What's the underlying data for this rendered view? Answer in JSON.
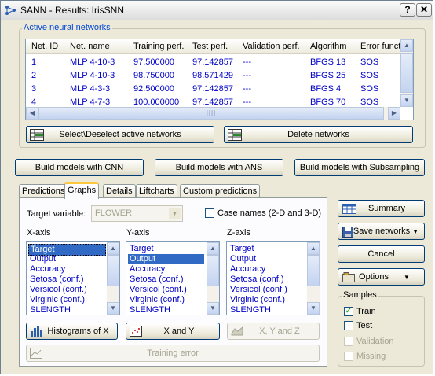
{
  "window": {
    "title": "SANN - Results: IrisSNN",
    "help_label": "?",
    "close_label": "✕"
  },
  "networks": {
    "group_label": "Active neural networks",
    "columns": [
      "Net. ID",
      "Net. name",
      "Training perf.",
      "Test perf.",
      "Validation perf.",
      "Algorithm",
      "Error funct"
    ],
    "rows": [
      [
        "1",
        "MLP 4-10-3",
        "97.500000",
        "97.142857",
        "---",
        "BFGS 13",
        "SOS"
      ],
      [
        "2",
        "MLP 4-10-3",
        "98.750000",
        "98.571429",
        "---",
        "BFGS 25",
        "SOS"
      ],
      [
        "3",
        "MLP 4-3-3",
        "92.500000",
        "97.142857",
        "---",
        "BFGS 4",
        "SOS"
      ],
      [
        "4",
        "MLP 4-7-3",
        "100.000000",
        "97.142857",
        "---",
        "BFGS 70",
        "SOS"
      ]
    ],
    "select_button": "Select\\Deselect active networks",
    "delete_button": "Delete networks"
  },
  "build": {
    "cnn": "Build models with CNN",
    "ans": "Build  models with ANS",
    "subsampling": "Build models with Subsampling"
  },
  "tabs": [
    "Predictions",
    "Graphs",
    "Details",
    "Liftcharts",
    "Custom predictions"
  ],
  "graphs": {
    "target_label": "Target variable:",
    "target_value": "FLOWER",
    "case_names_label": "Case names (2-D and 3-D)",
    "x_axis_label": "X-axis",
    "y_axis_label": "Y-axis",
    "z_axis_label": "Z-axis",
    "axis_items": [
      "Target",
      "Output",
      "Accuracy",
      "Setosa (conf.)",
      "Versicol (conf.)",
      "Virginic (conf.)",
      "SLENGTH"
    ],
    "histograms_button": "Histograms of X",
    "xy_button": "X and Y",
    "xyz_button": "X, Y and Z",
    "training_error_button": "Training error"
  },
  "side": {
    "summary": "Summary",
    "save_networks": "Save networks",
    "cancel": "Cancel",
    "options": "Options",
    "samples_label": "Samples",
    "train": "Train",
    "test": "Test",
    "validation": "Validation",
    "missing": "Missing",
    "train_checked": true,
    "test_checked": false
  },
  "colors": {
    "link_blue": "#0000c8",
    "selection": "#316ac5",
    "group_label": "#0046d5"
  }
}
